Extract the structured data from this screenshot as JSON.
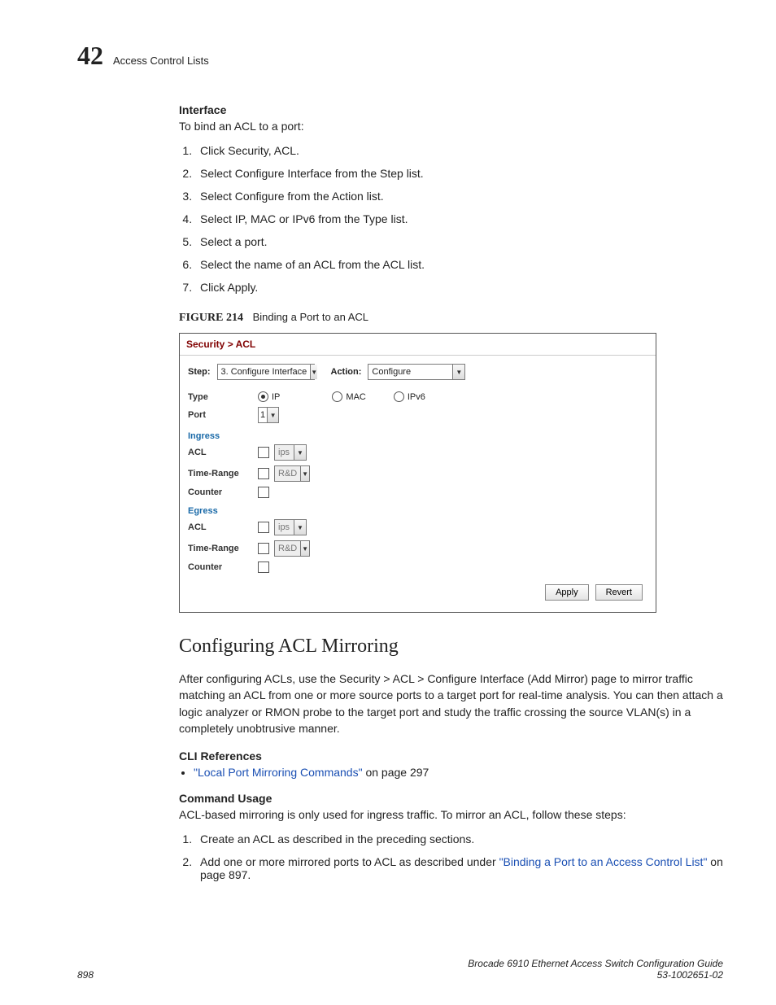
{
  "chapter": {
    "number": "42",
    "name": "Access Control Lists"
  },
  "interface": {
    "heading": "Interface",
    "intro": "To bind an ACL to a port:",
    "steps": [
      "Click Security, ACL.",
      "Select Configure Interface from the Step list.",
      "Select Configure from the Action list.",
      "Select IP, MAC or IPv6 from the Type list.",
      "Select a port.",
      "Select the name of an ACL from the ACL list.",
      "Click Apply."
    ]
  },
  "figure": {
    "label": "FIGURE 214",
    "title": "Binding a Port to an ACL",
    "breadcrumb": "Security > ACL",
    "stepLabel": "Step:",
    "stepValue": "3. Configure Interface",
    "actionLabel": "Action:",
    "actionValue": "Configure",
    "typeLabel": "Type",
    "typeOptions": {
      "ip": "IP",
      "mac": "MAC",
      "ipv6": "IPv6"
    },
    "portLabel": "Port",
    "portValue": "1",
    "ingressLabel": "Ingress",
    "egressLabel": "Egress",
    "aclLabel": "ACL",
    "aclValue": "ips",
    "timeRangeLabel": "Time-Range",
    "timeRangeValue": "R&D",
    "counterLabel": "Counter",
    "applyBtn": "Apply",
    "revertBtn": "Revert"
  },
  "mirroring": {
    "heading": "Configuring ACL Mirroring",
    "para": "After configuring ACLs, use the Security > ACL > Configure Interface (Add Mirror) page to mirror traffic matching an ACL from one or more source ports to a target port for real-time analysis. You can then attach a logic analyzer or RMON probe to the target port and study the traffic crossing the source VLAN(s) in a completely unobtrusive manner.",
    "cliHeading": "CLI References",
    "cliLink": "\"Local Port Mirroring Commands\"",
    "cliSuffix": " on page 297",
    "usageHeading": "Command Usage",
    "usageIntro": "ACL-based mirroring is only used for ingress traffic. To mirror an ACL, follow these steps:",
    "usageSteps": {
      "s1": "Create an ACL as described in the preceding sections.",
      "s2a": "Add one or more mirrored ports to ACL as described under ",
      "s2link": "\"Binding a Port to an Access Control List\"",
      "s2b": " on page 897."
    }
  },
  "footer": {
    "page": "898",
    "right1": "Brocade 6910 Ethernet Access Switch Configuration Guide",
    "right2": "53-1002651-02"
  }
}
